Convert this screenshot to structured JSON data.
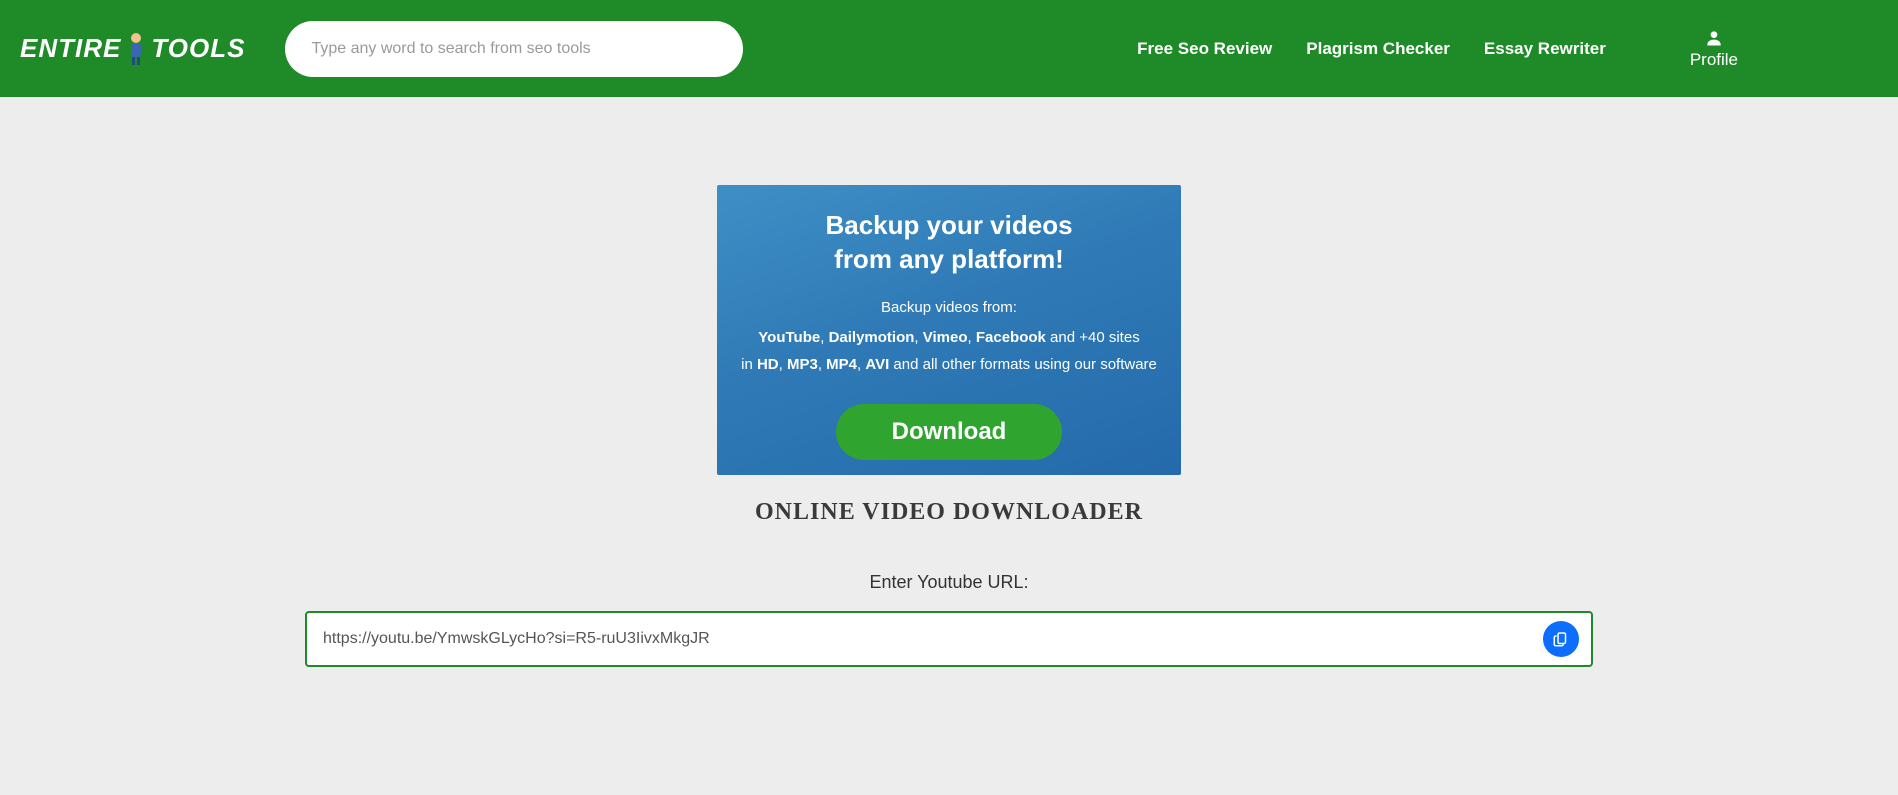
{
  "header": {
    "logo_left": "ENTIRE",
    "logo_right": "TOOLS",
    "search_placeholder": "Type any word to search from seo tools",
    "nav": [
      "Free Seo Review",
      "Plagrism Checker",
      "Essay Rewriter"
    ],
    "profile_label": "Profile"
  },
  "banner": {
    "title_line1": "Backup your videos",
    "title_line2": "from any platform!",
    "sub": "Backup videos from:",
    "download_label": "Download"
  },
  "page": {
    "title": "ONLINE VIDEO DOWNLOADER",
    "url_label": "Enter Youtube URL:",
    "url_value": "https://youtu.be/YmwskGLycHo?si=R5-ruU3IivxMkgJR"
  }
}
